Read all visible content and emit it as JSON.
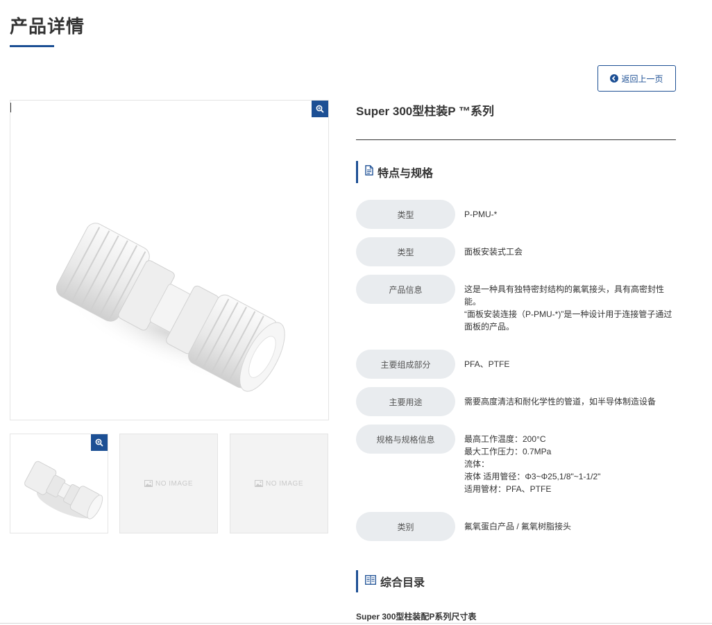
{
  "page": {
    "title": "产品详情"
  },
  "back_button": {
    "label": "返回上一页",
    "icon": "arrow-left-circle-icon"
  },
  "gallery": {
    "main_zoom_icon": "zoom-in-icon",
    "thumbnails": [
      {
        "type": "image",
        "zoom_icon": "zoom-in-icon"
      },
      {
        "type": "placeholder",
        "text": "NO IMAGE"
      },
      {
        "type": "placeholder",
        "text": "NO IMAGE"
      }
    ]
  },
  "product": {
    "title": "Super 300型柱装P ™系列"
  },
  "features": {
    "heading": "特点与规格",
    "icon": "document-icon",
    "rows": [
      {
        "label": "类型",
        "lines": [
          "P-PMU-*"
        ]
      },
      {
        "label": "类型",
        "lines": [
          "面板安装式工会"
        ]
      },
      {
        "label": "产品信息",
        "lines": [
          "这是一种具有独特密封结构的氟氧接头，具有高密封性能。",
          "“面板安装连接（P-PMU-*)”是一种设计用于连接管子通过面板的产品。"
        ]
      },
      {
        "label": "主要组成部分",
        "lines": [
          "PFA、PTFE"
        ]
      },
      {
        "label": "主要用途",
        "lines": [
          "需要高度清洁和耐化学性的管道，如半导体制造设备"
        ]
      },
      {
        "label": "规格与规格信息",
        "lines": [
          "最高工作温度：200°C",
          "最大工作压力：0.7MPa",
          "流体：",
          "液体 适用管径：Φ3~Φ25,1/8\"~1-1/2\"",
          "适用管材：PFA、PTFE"
        ]
      },
      {
        "label": "类别",
        "lines": [
          "氟氧蛋白产品 / 氟氧树脂接头"
        ]
      }
    ]
  },
  "catalog": {
    "heading": "综合目录",
    "icon": "catalog-book-icon",
    "link_text": "Super 300型柱装配P系列尺寸表"
  },
  "colors": {
    "accent": "#1c4f94",
    "label_bg": "#e9ecef",
    "text": "#333333"
  }
}
